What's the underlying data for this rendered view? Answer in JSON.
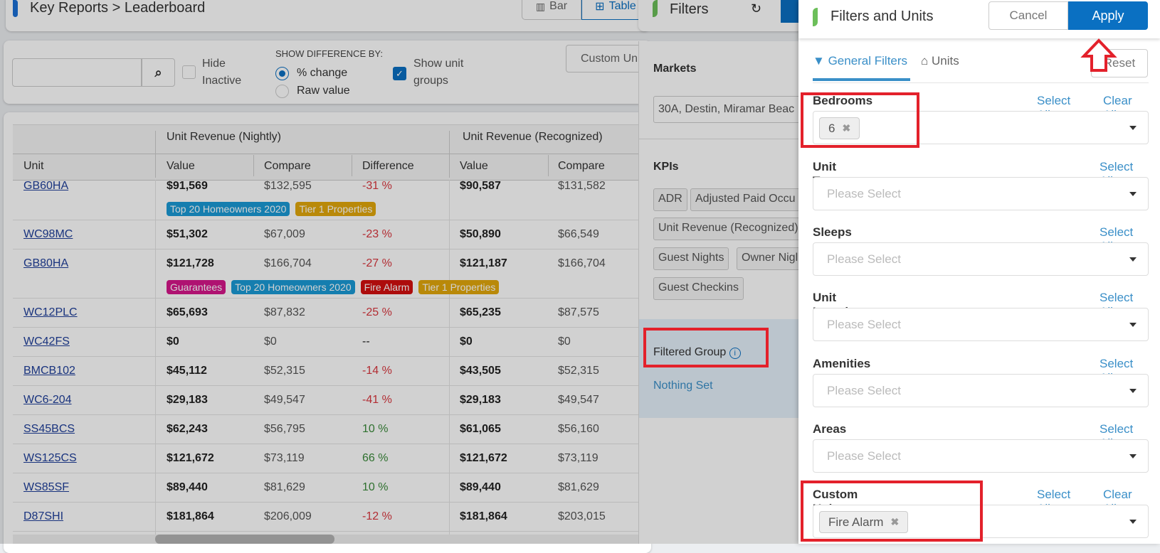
{
  "header": {
    "breadcrumb": "Key Reports > Leaderboard",
    "view_bar": "Bar",
    "view_table": "Table"
  },
  "toolbar": {
    "search_placeholder": "",
    "hide_inactive": "Hide Inactive",
    "hide_inactive_checked": false,
    "show_diff_label": "SHOW DIFFERENCE BY:",
    "pct_change": "% change",
    "raw_value": "Raw value",
    "selected": "% change",
    "show_unit_groups": "Show unit groups",
    "show_unit_groups_checked": true,
    "custom_units_btn": "Custom Un"
  },
  "table": {
    "group_headers": [
      "Unit Revenue (Nightly)",
      "Unit Revenue (Recognized)"
    ],
    "columns": [
      "Unit",
      "Value",
      "Compare",
      "Difference",
      "Value",
      "Compare"
    ],
    "rows": [
      {
        "unit": "GB60HA",
        "v1": "$91,569",
        "c1": "$132,595",
        "d": "-31 %",
        "dir": "neg",
        "v2": "$90,587",
        "c2": "$131,582",
        "tags": [
          {
            "label": "Top 20 Homeowners 2020",
            "color": "#1a9ad6"
          },
          {
            "label": "Tier 1 Properties",
            "color": "#e2a80c"
          }
        ]
      },
      {
        "unit": "WC98MC",
        "v1": "$51,302",
        "c1": "$67,009",
        "d": "-23 %",
        "dir": "neg",
        "v2": "$50,890",
        "c2": "$66,549",
        "tags": []
      },
      {
        "unit": "GB80HA",
        "v1": "$121,728",
        "c1": "$166,704",
        "d": "-27 %",
        "dir": "neg",
        "v2": "$121,187",
        "c2": "$166,704",
        "tags": [
          {
            "label": "Guarantees",
            "color": "#d6168a"
          },
          {
            "label": "Top 20 Homeowners 2020",
            "color": "#1a9ad6"
          },
          {
            "label": "Fire Alarm",
            "color": "#d40f0f"
          },
          {
            "label": "Tier 1 Properties",
            "color": "#e2a80c"
          }
        ]
      },
      {
        "unit": "WC12PLC",
        "v1": "$65,693",
        "c1": "$87,832",
        "d": "-25 %",
        "dir": "neg",
        "v2": "$65,235",
        "c2": "$87,575",
        "tags": []
      },
      {
        "unit": "WC42FS",
        "v1": "$0",
        "c1": "$0",
        "d": "--",
        "dir": "none",
        "v2": "$0",
        "c2": "$0",
        "tags": []
      },
      {
        "unit": "BMCB102",
        "v1": "$45,112",
        "c1": "$52,315",
        "d": "-14 %",
        "dir": "neg",
        "v2": "$43,505",
        "c2": "$52,315",
        "tags": []
      },
      {
        "unit": "WC6-204",
        "v1": "$29,183",
        "c1": "$49,547",
        "d": "-41 %",
        "dir": "neg",
        "v2": "$29,183",
        "c2": "$49,547",
        "tags": []
      },
      {
        "unit": "SS45BCS",
        "v1": "$62,243",
        "c1": "$56,795",
        "d": "10 %",
        "dir": "pos",
        "v2": "$61,065",
        "c2": "$56,160",
        "tags": []
      },
      {
        "unit": "WS125CS",
        "v1": "$121,672",
        "c1": "$73,119",
        "d": "66 %",
        "dir": "pos",
        "v2": "$121,672",
        "c2": "$73,119",
        "tags": []
      },
      {
        "unit": "WS85SF",
        "v1": "$89,440",
        "c1": "$81,629",
        "d": "10 %",
        "dir": "pos",
        "v2": "$89,440",
        "c2": "$81,629",
        "tags": []
      },
      {
        "unit": "D87SHI",
        "v1": "$181,864",
        "c1": "$206,009",
        "d": "-12 %",
        "dir": "neg",
        "v2": "$181,864",
        "c2": "$203,015",
        "tags": []
      }
    ]
  },
  "filters_panel": {
    "title": "Filters",
    "markets_label": "Markets",
    "markets_value": "30A, Destin, Miramar Beac",
    "kpis_label": "KPIs",
    "kpis": [
      "ADR",
      "Adjusted Paid Occu",
      "Unit Revenue (Recognized)",
      "Guest Nights",
      "Owner Nigl",
      "Guest Checkins"
    ],
    "filtered_group_label": "Filtered Group",
    "filtered_group_value": "Nothing Set"
  },
  "drawer": {
    "title": "Filters and Units",
    "cancel": "Cancel",
    "apply": "Apply",
    "reset": "Reset",
    "tabs": [
      {
        "label": "General Filters",
        "icon": "filter-icon",
        "active": true
      },
      {
        "label": "Units",
        "icon": "home-icon",
        "active": false
      }
    ],
    "select_all": "Select All",
    "clear_all": "Clear All",
    "placeholder": "Please Select",
    "fields": {
      "bedrooms": {
        "label": "Bedrooms",
        "chip": "6"
      },
      "unit_type": {
        "label": "Unit Type"
      },
      "sleeps": {
        "label": "Sleeps"
      },
      "unit_location": {
        "label": "Unit Location"
      },
      "amenities": {
        "label": "Amenities"
      },
      "areas": {
        "label": "Areas"
      },
      "custom_unit_groups": {
        "label": "Custom Unit Groups",
        "chip": "Fire Alarm"
      }
    }
  },
  "colors": {
    "primary": "#0a70c2",
    "accent_green": "#6cbf5a",
    "highlight": "#e3212b",
    "link": "#3a8fc8"
  }
}
